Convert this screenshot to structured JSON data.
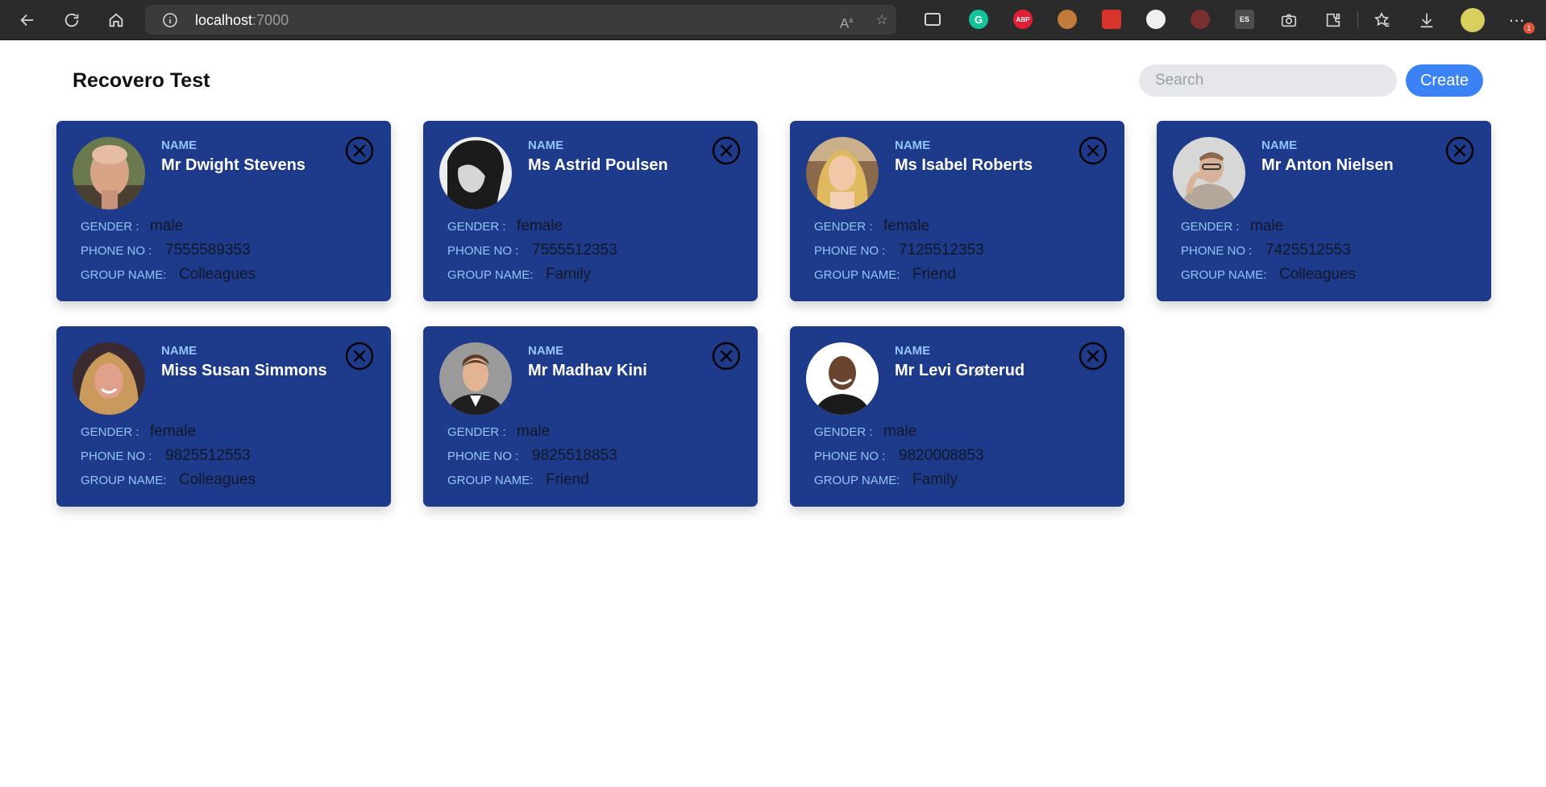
{
  "browser": {
    "host": "localhost",
    "port": ":7000",
    "extensions": [
      {
        "icon": "grammarly-icon",
        "text": "G",
        "color": "#15c39a"
      },
      {
        "icon": "adblock-plus-icon",
        "text": "ABP",
        "color": "#e31e35"
      },
      {
        "icon": "cookie-icon",
        "text": "",
        "color": "#c27b3b"
      },
      {
        "icon": "paint-extension-icon",
        "text": "",
        "color": "#d9342b"
      },
      {
        "icon": "dark-reader-icon",
        "text": "",
        "color": "#f0f0f0"
      },
      {
        "icon": "spy-glasses-icon",
        "text": "",
        "color": "#c04b4b"
      },
      {
        "icon": "es-extension-icon",
        "text": "ES",
        "color": "#4d4d4d"
      }
    ],
    "profile_badge": "1"
  },
  "header": {
    "title": "Recovero Test",
    "search_placeholder": "Search",
    "create_label": "Create"
  },
  "labels": {
    "name": "NAME",
    "gender": "GENDER :",
    "phone": "PHONE NO :",
    "group": "GROUP NAME:"
  },
  "colors": {
    "card_background": "#1e3a8a",
    "label_color": "#93c5fd",
    "create_button": "#3b82f6"
  },
  "contacts": [
    {
      "name": "Mr Dwight Stevens",
      "gender": "male",
      "phone": "7555589353",
      "group": "Colleagues",
      "avatar": "photo-bald-man"
    },
    {
      "name": "Ms Astrid Poulsen",
      "gender": "female",
      "phone": "7555512353",
      "group": "Family",
      "avatar": "photo-woman-bw"
    },
    {
      "name": "Ms Isabel Roberts",
      "gender": "female",
      "phone": "7125512353",
      "group": "Friend",
      "avatar": "photo-blonde-woman"
    },
    {
      "name": "Mr Anton Nielsen",
      "gender": "male",
      "phone": "7425512553",
      "group": "Colleagues",
      "avatar": "photo-man-glasses"
    },
    {
      "name": "Miss Susan Simmons",
      "gender": "female",
      "phone": "9825512553",
      "group": "Colleagues",
      "avatar": "photo-smiling-woman"
    },
    {
      "name": "Mr Madhav Kini",
      "gender": "male",
      "phone": "9825518853",
      "group": "Friend",
      "avatar": "photo-young-man"
    },
    {
      "name": "Mr Levi Grøterud",
      "gender": "male",
      "phone": "9820008853",
      "group": "Family",
      "avatar": "photo-smiling-man"
    }
  ]
}
